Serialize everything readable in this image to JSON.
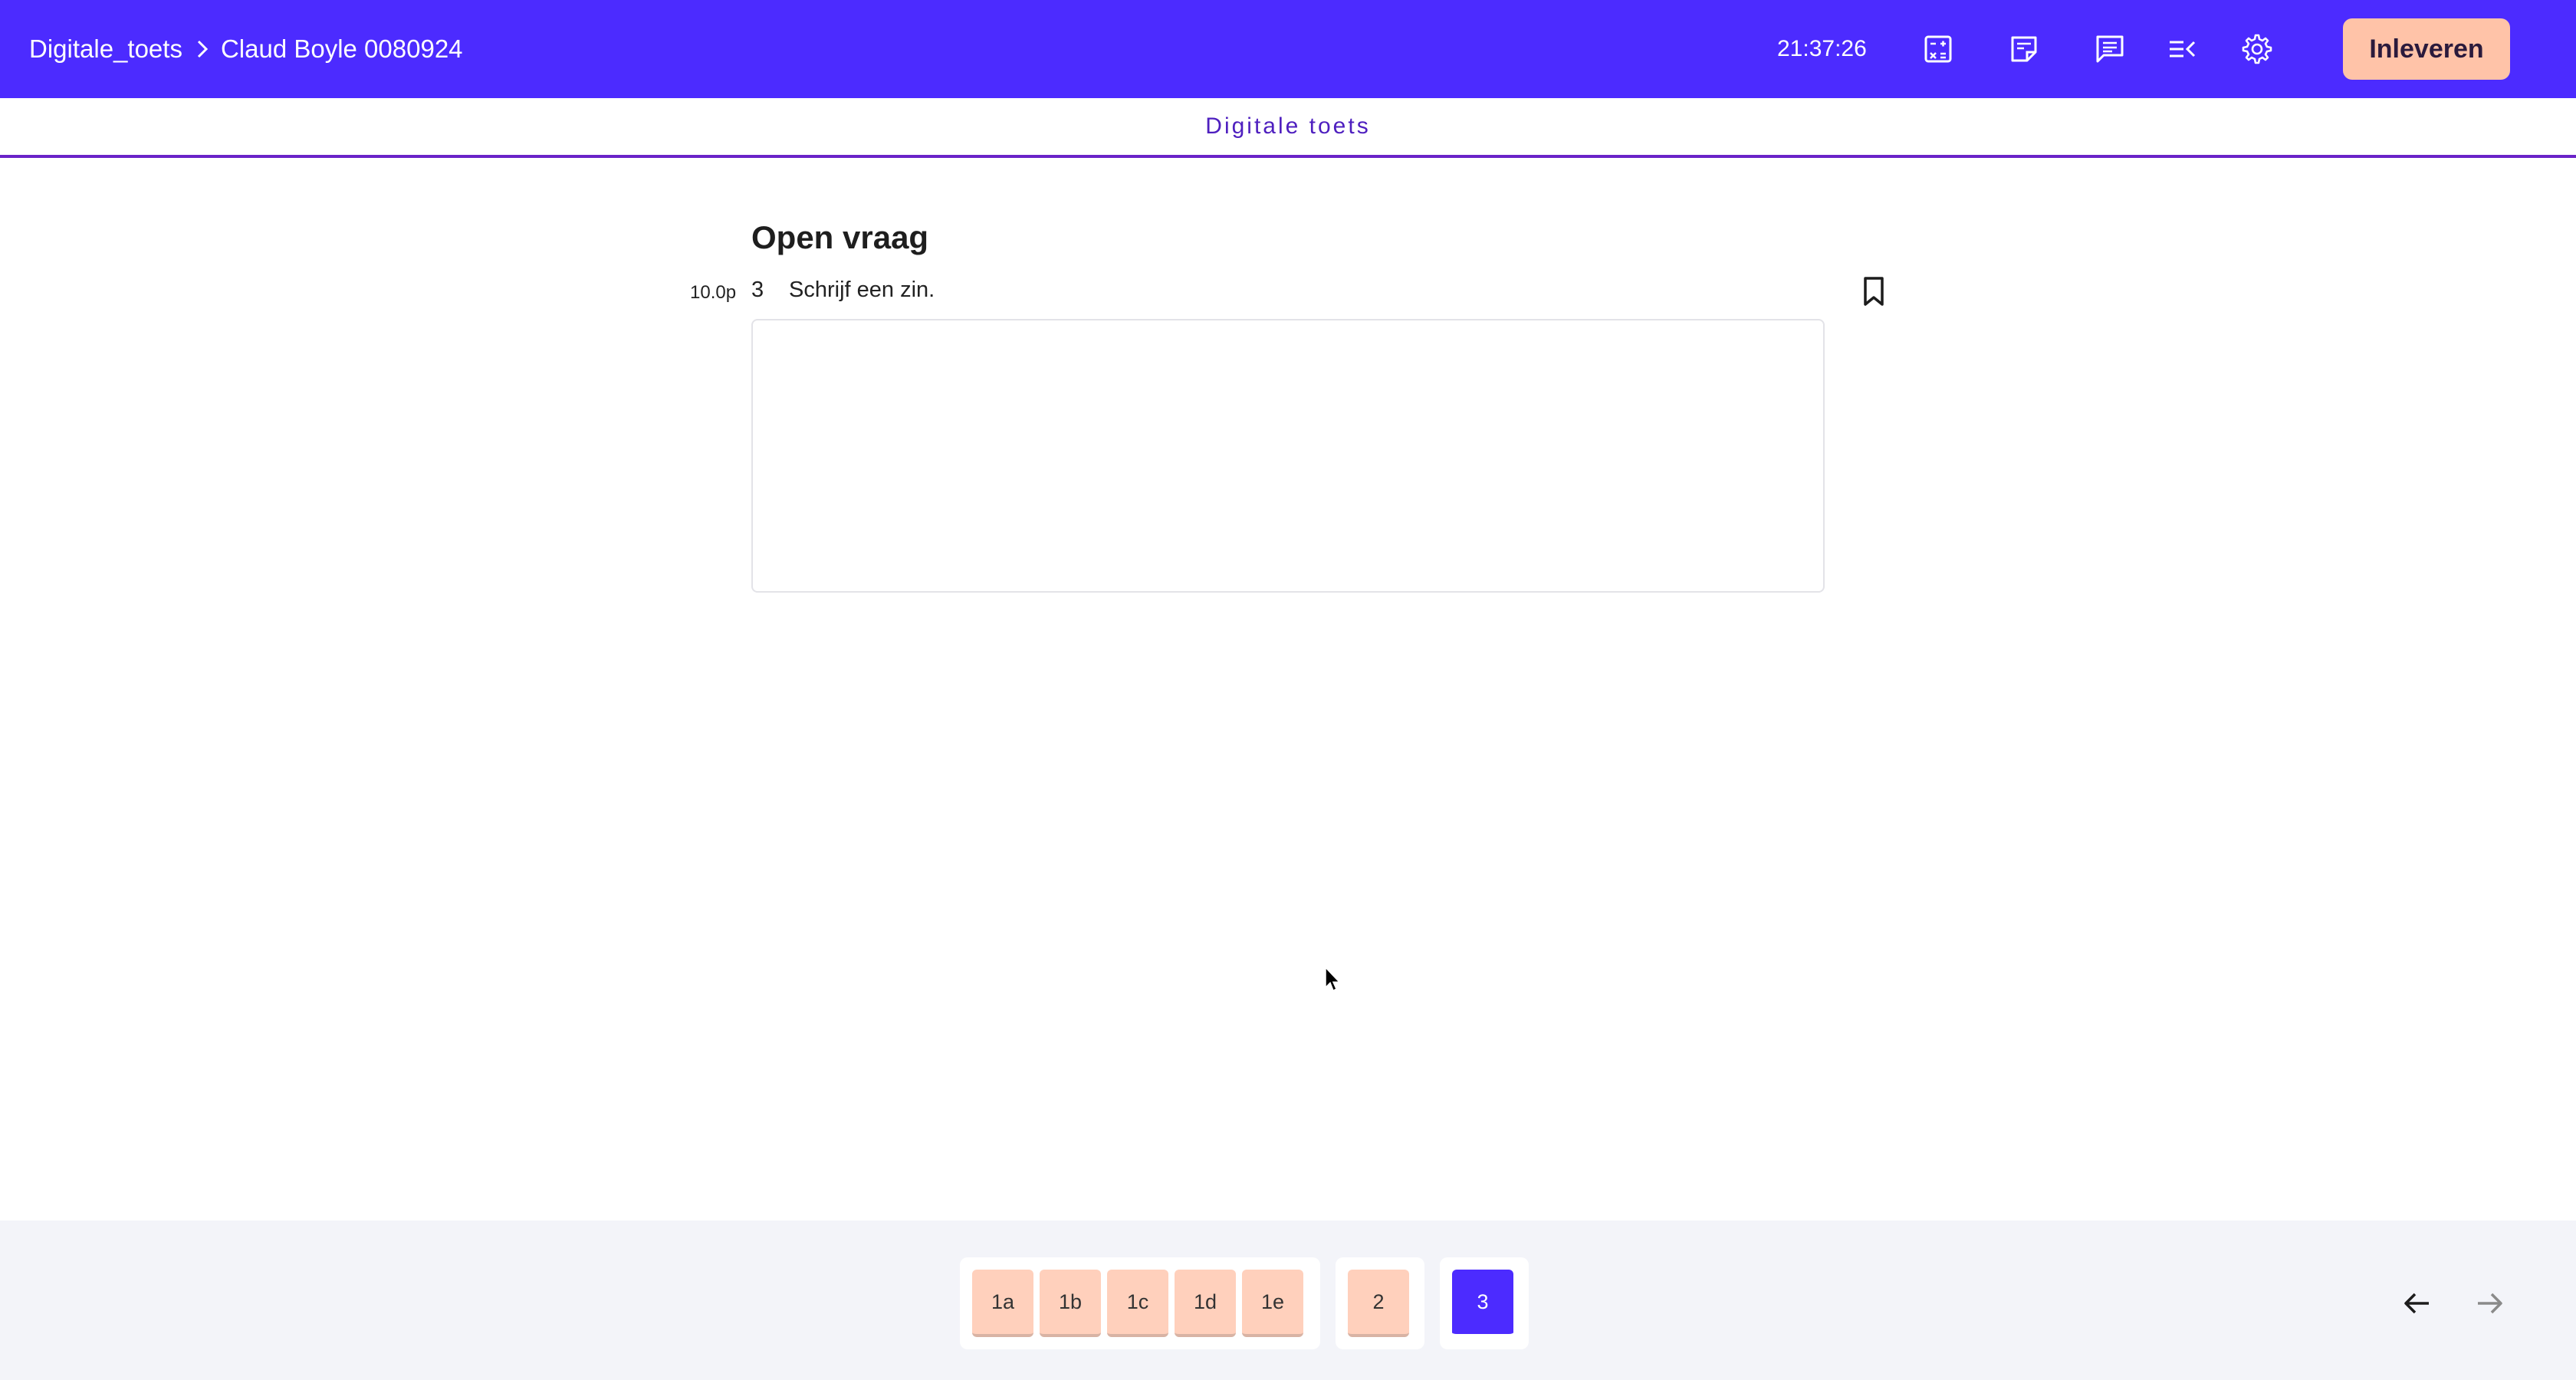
{
  "header": {
    "test_name": "Digitale_toets",
    "student_name": "Claud Boyle 0080924",
    "clock": "21:37:26",
    "submit_label": "Inleveren",
    "tools": [
      "calculator-icon",
      "notes-icon",
      "comment-icon",
      "text-to-speech-icon",
      "settings-icon"
    ]
  },
  "subheader": {
    "title": "Digitale toets"
  },
  "question": {
    "section_title": "Open vraag",
    "points": "10.0p",
    "number": "3",
    "text": "Schrijf een zin.",
    "answer_value": ""
  },
  "navigation": {
    "groups": [
      {
        "items": [
          "1a",
          "1b",
          "1c",
          "1d",
          "1e"
        ]
      },
      {
        "items": [
          "2"
        ]
      },
      {
        "items": [
          "3"
        ]
      }
    ],
    "active_item": "3"
  },
  "colors": {
    "primary": "#4c2bff",
    "answered": "#ffd0bc",
    "submit": "#ffc3a8",
    "divider": "#6a22c8"
  }
}
